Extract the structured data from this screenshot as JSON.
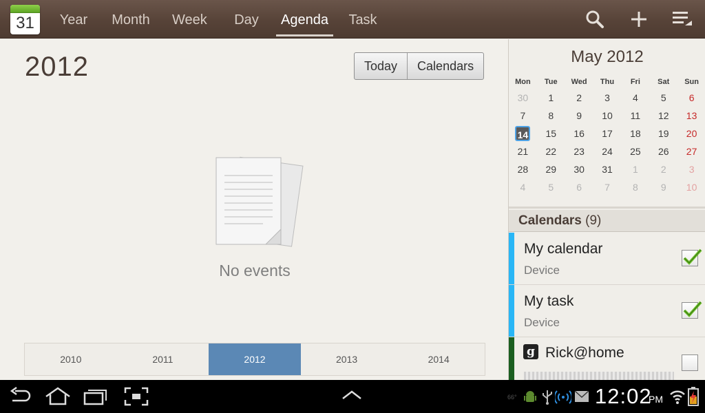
{
  "app": {
    "icon_day": "31"
  },
  "tabs": [
    {
      "label": "Year",
      "active": false
    },
    {
      "label": "Month",
      "active": false
    },
    {
      "label": "Week",
      "active": false
    },
    {
      "label": "Day",
      "active": false
    },
    {
      "label": "Agenda",
      "active": true
    },
    {
      "label": "Task",
      "active": false
    }
  ],
  "toolbar_icons": [
    "search-icon",
    "add-icon",
    "menu-icon"
  ],
  "agenda": {
    "year_title": "2012",
    "today_button": "Today",
    "calendars_button": "Calendars",
    "empty_message": "No events",
    "years": [
      "2010",
      "2011",
      "2012",
      "2013",
      "2014"
    ],
    "selected_year": "2012"
  },
  "mini_calendar": {
    "title": "May 2012",
    "weekdays": [
      "Mon",
      "Tue",
      "Wed",
      "Thu",
      "Fri",
      "Sat",
      "Sun"
    ],
    "weeks": [
      [
        "30",
        "1",
        "2",
        "3",
        "4",
        "5",
        "6"
      ],
      [
        "7",
        "8",
        "9",
        "10",
        "11",
        "12",
        "13"
      ],
      [
        "14",
        "15",
        "16",
        "17",
        "18",
        "19",
        "20"
      ],
      [
        "21",
        "22",
        "23",
        "24",
        "25",
        "26",
        "27"
      ],
      [
        "28",
        "29",
        "30",
        "31",
        "1",
        "2",
        "3"
      ],
      [
        "4",
        "5",
        "6",
        "7",
        "8",
        "9",
        "10"
      ]
    ],
    "today": "14"
  },
  "calendars": {
    "label": "Calendars",
    "count": "(9)",
    "items": [
      {
        "name": "My calendar",
        "sub": "Device",
        "color": "#29b6f6",
        "checked": true
      },
      {
        "name": "My task",
        "sub": "Device",
        "color": "#29b6f6",
        "checked": true
      },
      {
        "name": "Rick@home",
        "sub": "",
        "color": "#1b5e20",
        "checked": false
      }
    ]
  },
  "status_bar": {
    "temperature": "66°",
    "time": "12:02",
    "ampm": "PM",
    "nav_icons": [
      "back-icon",
      "home-icon",
      "recent-apps-icon",
      "screenshot-icon",
      "up-chevron-icon"
    ],
    "status_icons": [
      "android-debug-icon",
      "usb-icon",
      "wifi-hotspot-icon",
      "mail-icon",
      "wifi-icon",
      "battery-charging-icon"
    ]
  }
}
